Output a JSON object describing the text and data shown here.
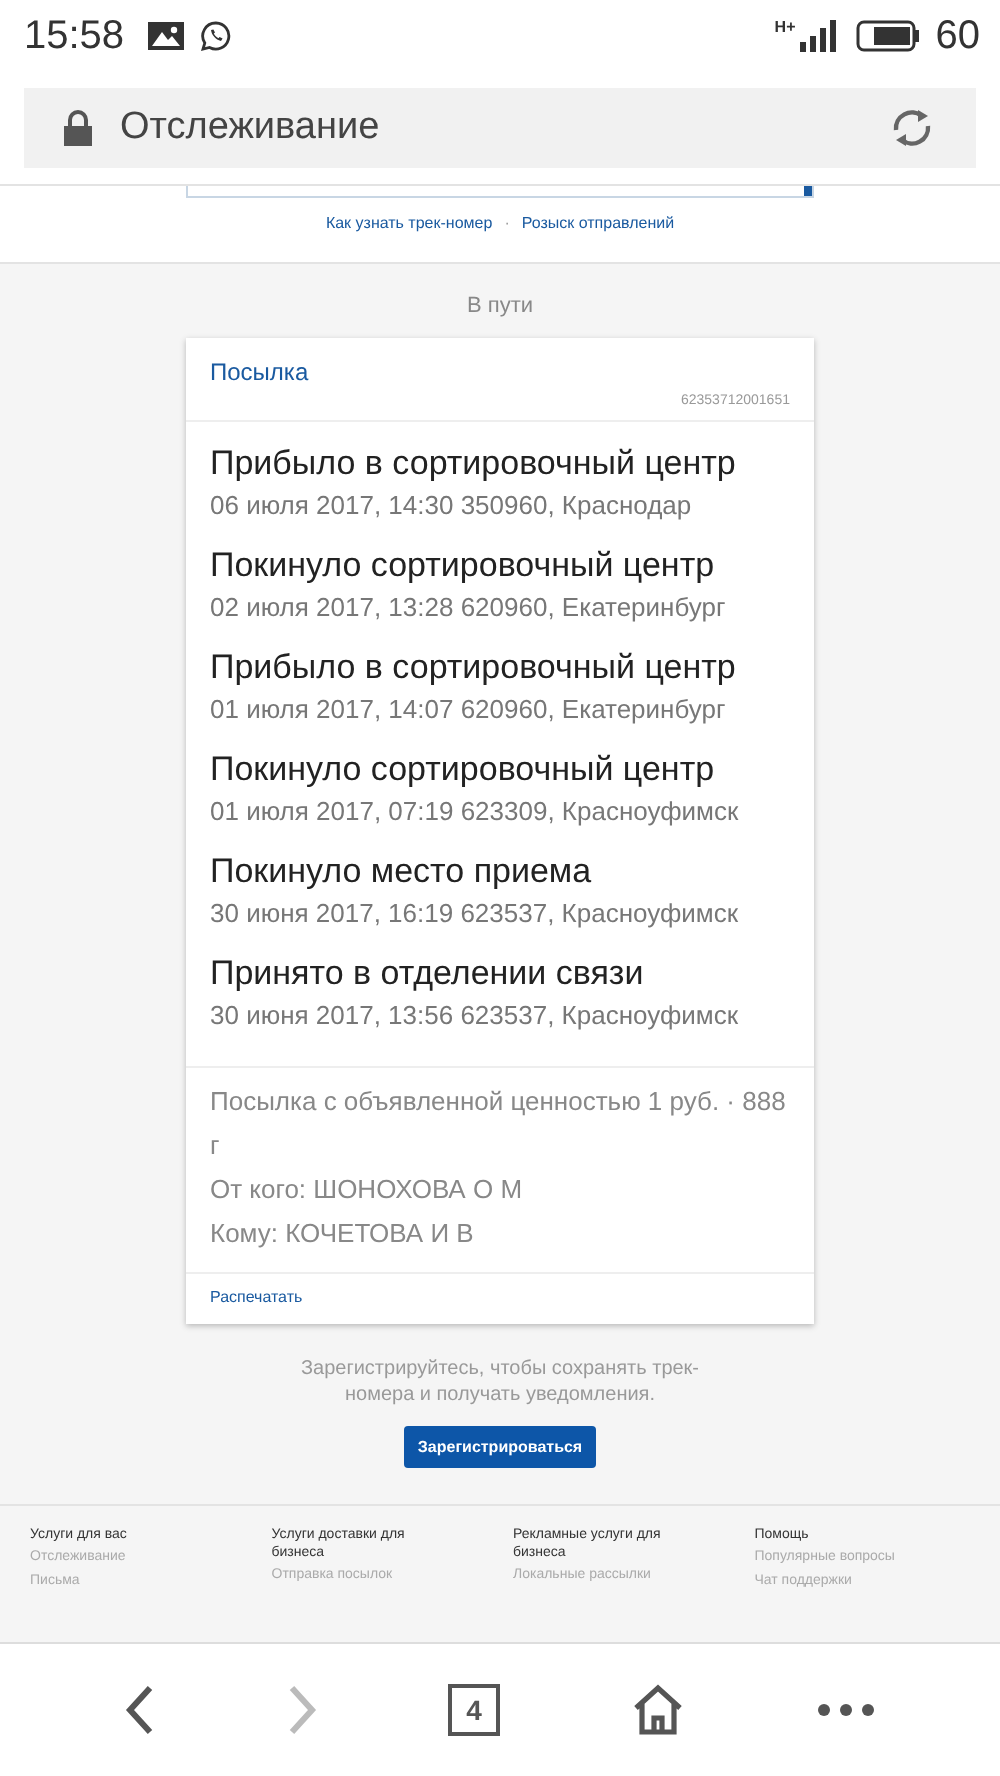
{
  "status_bar": {
    "time": "15:58",
    "network": "H+",
    "battery": "60"
  },
  "address_bar": {
    "title": "Отслеживание"
  },
  "links": [
    "Как узнать трек-номер",
    "Розыск отправлений"
  ],
  "link_separator": "·",
  "status_heading": "В пути",
  "card": {
    "type": "Посылка",
    "track_number": "62353712001651",
    "events": [
      {
        "title": "Прибыло в сортировочный центр",
        "details": "06 июля 2017, 14:30 350960, Краснодар"
      },
      {
        "title": "Покинуло сортировочный центр",
        "details": "02 июля 2017, 13:28 620960, Екатеринбург"
      },
      {
        "title": "Прибыло в сортировочный центр",
        "details": "01 июля 2017, 14:07 620960, Екатеринбург"
      },
      {
        "title": "Покинуло сортировочный центр",
        "details": "01 июля 2017, 07:19 623309, Красноуфимск"
      },
      {
        "title": "Покинуло место приема",
        "details": "30 июня 2017, 16:19 623537, Красноуфимск"
      },
      {
        "title": "Принято в отделении связи",
        "details": "30 июня 2017, 13:56 623537, Красноуфимск"
      }
    ],
    "info": [
      "Посылка с объявленной ценностью 1 руб. · 888 г",
      "От кого: ШОНОХОВА О М",
      "Кому: КОЧЕТОВА И В"
    ],
    "print_link": "Распечатать"
  },
  "register": {
    "text": "Зарегистрируйтесь, чтобы сохранять трек-номера и получать уведомления.",
    "button": "Зарегистрироваться"
  },
  "footer": [
    {
      "heading": "Услуги для вас",
      "items": [
        "Отслеживание",
        "Письма"
      ]
    },
    {
      "heading": "Услуги доставки для бизнеса",
      "items": [
        "Отправка посылок"
      ]
    },
    {
      "heading": "Рекламные услуги для бизнеса",
      "items": [
        "Локальные рассылки"
      ]
    },
    {
      "heading": "Помощь",
      "items": [
        "Популярные вопросы",
        "Чат поддержки"
      ]
    }
  ],
  "nav": [
    {
      "kind": "back",
      "disabled": false
    },
    {
      "kind": "forward",
      "disabled": true
    },
    {
      "kind": "tabs",
      "label": "4",
      "disabled": false
    },
    {
      "kind": "home",
      "disabled": false
    },
    {
      "kind": "menu",
      "disabled": false
    }
  ]
}
